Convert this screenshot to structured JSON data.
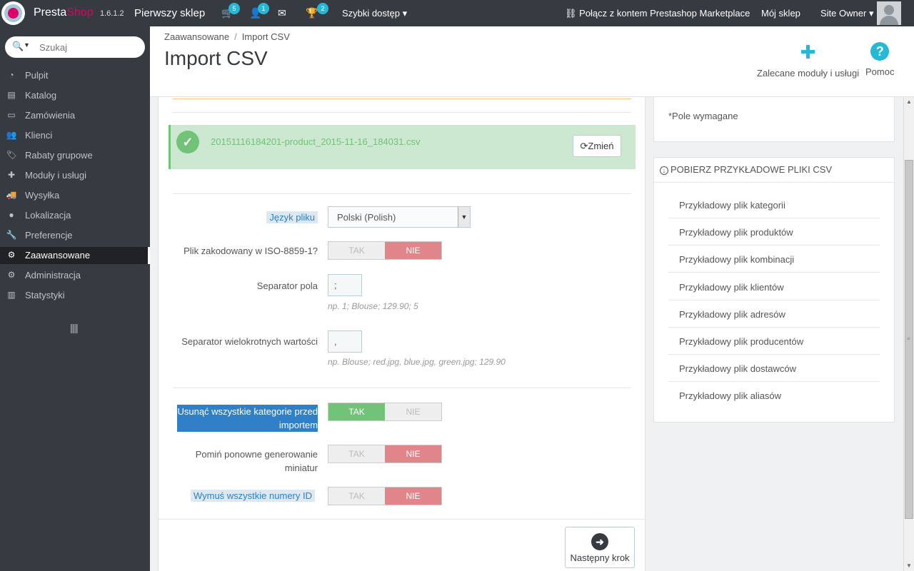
{
  "header": {
    "brand_part1": "Presta",
    "brand_part2": "Shop",
    "version": "1.6.1.2",
    "shop_name": "Pierwszy sklep",
    "orders_badge": "5",
    "customers_badge": "1",
    "messages_badge": "",
    "trophy_badge": "2",
    "quick_access": "Szybki dostęp",
    "connect": "Połącz z kontem Prestashop Marketplace",
    "my_shop": "Mój sklep",
    "user": "Site Owner"
  },
  "sidebar": {
    "search_placeholder": "Szukaj",
    "items": [
      {
        "label": "Pulpit",
        "icon": "dashboard-icon"
      },
      {
        "label": "Katalog",
        "icon": "book-icon"
      },
      {
        "label": "Zamówienia",
        "icon": "credit-card-icon"
      },
      {
        "label": "Klienci",
        "icon": "users-icon"
      },
      {
        "label": "Rabaty grupowe",
        "icon": "tags-icon"
      },
      {
        "label": "Moduły i usługi",
        "icon": "puzzle-icon"
      },
      {
        "label": "Wysyłka",
        "icon": "truck-icon"
      },
      {
        "label": "Lokalizacja",
        "icon": "globe-icon"
      },
      {
        "label": "Preferencje",
        "icon": "wrench-icon"
      },
      {
        "label": "Zaawansowane",
        "icon": "cogs-icon",
        "active": true
      },
      {
        "label": "Administracja",
        "icon": "cog-icon"
      },
      {
        "label": "Statystyki",
        "icon": "bar-chart-icon"
      }
    ]
  },
  "page": {
    "breadcrumb": [
      "Zaawansowane",
      "Import CSV"
    ],
    "title": "Import CSV",
    "toolbar": {
      "modules": "Zalecane moduły i usługi",
      "help": "Pomoc"
    }
  },
  "form": {
    "file_name": "20151116184201-product_2015-11-16_184031.csv",
    "change_button": "Zmień",
    "language_label": "Język pliku",
    "language_value": "Polski (Polish)",
    "iso_label": "Plik zakodowany w ISO-8859-1?",
    "yes": "TAK",
    "no": "NIE",
    "field_sep_label": "Separator pola",
    "field_sep_value": ";",
    "field_sep_hint": "np. 1; Blouse; 129.90; 5",
    "multi_sep_label": "Separator wielokrotnych wartości",
    "multi_sep_value": ",",
    "multi_sep_hint": "np. Blouse; red.jpg, blue.jpg, green.jpg; 129.90",
    "delete_cats_label_1": "Usunąć wszystkie kategorie przed",
    "delete_cats_label_2": "importem",
    "skip_thumbs_label_1": "Pomiń ponowne generowanie",
    "skip_thumbs_label_2": "miniatur",
    "force_ids_label": "Wymuś wszystkie numery ID",
    "next_button": "Następny krok"
  },
  "required_note": "*Pole wymagane",
  "samples": {
    "title": "Pobierz przykładowe pliki CSV",
    "items": [
      "Przykładowy plik kategorii",
      "Przykładowy plik produktów",
      "Przykładowy plik kombinacji",
      "Przykładowy plik klientów",
      "Przykładowy plik adresów",
      "Przykładowy plik producentów",
      "Przykładowy plik dostawców",
      "Przykładowy plik aliasów"
    ]
  }
}
